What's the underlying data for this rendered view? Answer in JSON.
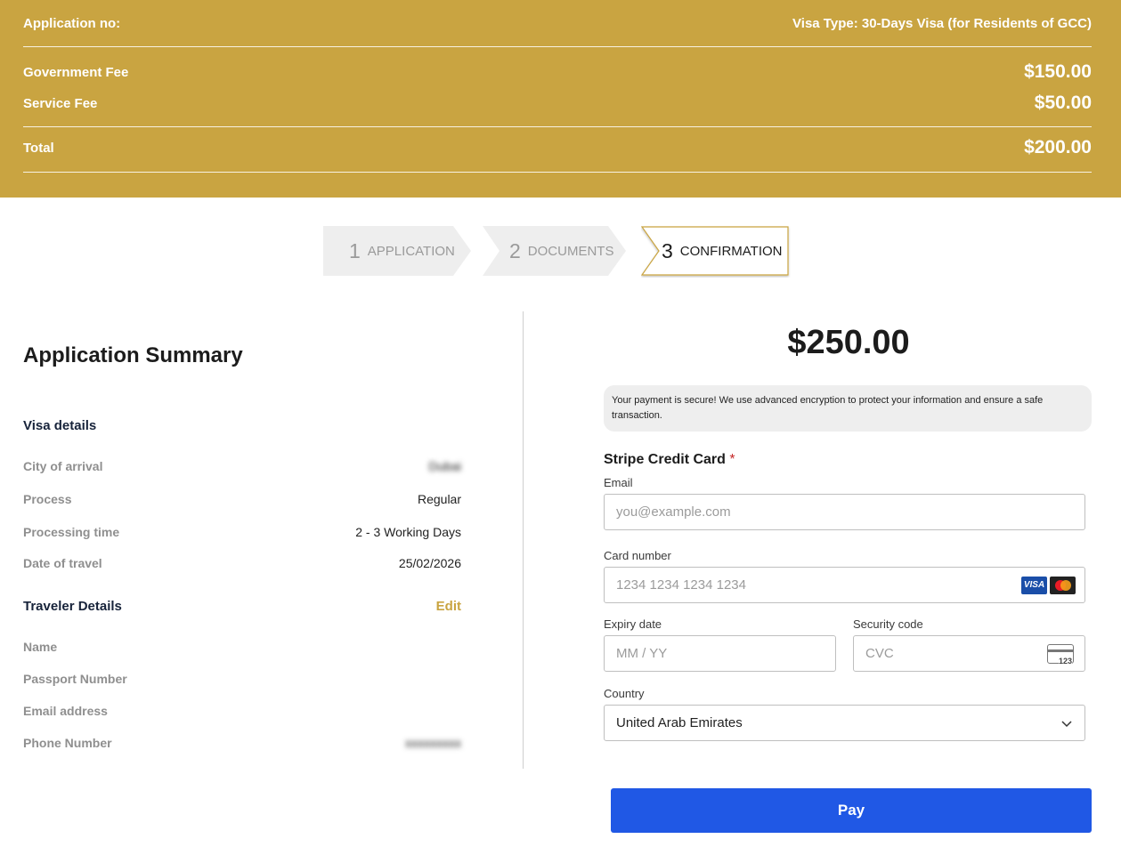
{
  "header": {
    "application_no_label": "Application no:",
    "visa_type": "Visa Type: 30-Days Visa (for Residents of GCC)",
    "fees": [
      {
        "label": "Government Fee",
        "value": "$150.00"
      },
      {
        "label": "Service Fee",
        "value": "$50.00"
      }
    ],
    "total_label": "Total",
    "total_value": "$200.00"
  },
  "stepper": {
    "steps": [
      {
        "num": "1",
        "label": "APPLICATION",
        "state": "inactive"
      },
      {
        "num": "2",
        "label": "DOCUMENTS",
        "state": "inactive"
      },
      {
        "num": "3",
        "label": "CONFIRMATION",
        "state": "active"
      }
    ]
  },
  "summary": {
    "title": "Application Summary",
    "visa_details_title": "Visa details",
    "visa_details": [
      {
        "label": "City of arrival",
        "value": "Dubai",
        "blurred": true
      },
      {
        "label": "Process",
        "value": "Regular"
      },
      {
        "label": "Processing time",
        "value": "2 - 3 Working Days"
      },
      {
        "label": "Date of travel",
        "value": "25/02/2026"
      }
    ],
    "traveler_title": "Traveler Details",
    "edit_label": "Edit",
    "traveler": [
      {
        "label": "Name",
        "value": ""
      },
      {
        "label": "Passport Number",
        "value": ""
      },
      {
        "label": "Email address",
        "value": ""
      },
      {
        "label": "Phone Number",
        "value": "xxxxxxxxx",
        "blurred": true
      }
    ]
  },
  "payment": {
    "amount": "$250.00",
    "secure_note": "Your payment is secure! We use advanced encryption to protect your information and ensure a safe transaction.",
    "stripe_label": "Stripe Credit Card",
    "required_mark": "*",
    "email_label": "Email",
    "email_placeholder": "you@example.com",
    "card_label": "Card number",
    "card_placeholder": "1234 1234 1234 1234",
    "card_brands": [
      "VISA",
      "mastercard"
    ],
    "expiry_label": "Expiry date",
    "expiry_placeholder": "MM / YY",
    "cvc_label": "Security code",
    "cvc_placeholder": "CVC",
    "cvc_icon_text": "123",
    "country_label": "Country",
    "country_value": "United Arab Emirates",
    "pay_label": "Pay"
  },
  "colors": {
    "brand_gold": "#c9a441",
    "pay_blue": "#2058e5"
  }
}
